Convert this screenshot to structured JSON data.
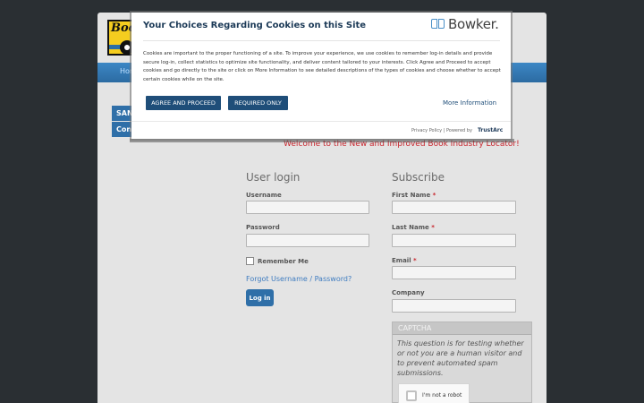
{
  "background": {
    "logo_text": "Boo",
    "nav_home": "Hom",
    "side_tabs": [
      "SAN",
      "Cont"
    ],
    "welcome": "Welcome to the New and Improved Book Industry Locator!",
    "login": {
      "title": "User login",
      "username_label": "Username",
      "password_label": "Password",
      "remember_label": "Remember Me",
      "forgot_link": "Forgot Username / Password?",
      "login_button": "Log in"
    },
    "subscribe": {
      "title": "Subscribe",
      "first_name_label": "First Name",
      "last_name_label": "Last Name",
      "email_label": "Email",
      "company_label": "Company",
      "required_mark": "*"
    },
    "captcha": {
      "title": "CAPTCHA",
      "description": "This question is for testing whether or not you are a human visitor and to prevent automated spam submissions.",
      "recaptcha_label": "I'm not a robot"
    }
  },
  "cookie_modal": {
    "title": "Your Choices Regarding Cookies on this Site",
    "brand": "Bowker.",
    "body": "Cookies are important to the proper functioning of a site. To improve your experience, we use cookies to remember log-in details and provide secure log-in, collect statistics to optimize site functionality, and deliver content tailored to your interests. Click Agree and Proceed to accept cookies and go directly to the site or click on More Information to see detailed descriptions of the types of cookies and choose whether to accept certain cookies while on the site.",
    "agree_button": "AGREE AND PROCEED",
    "required_button": "REQUIRED ONLY",
    "more_info": "More Information",
    "footer_text": "Privacy Policy | Powered by",
    "footer_brand": "TrustArc"
  },
  "colors": {
    "primary": "#2f6fa8",
    "modal_button": "#1f4e79",
    "welcome_red": "#c8262e",
    "logo_yellow": "#f5cd1f"
  }
}
